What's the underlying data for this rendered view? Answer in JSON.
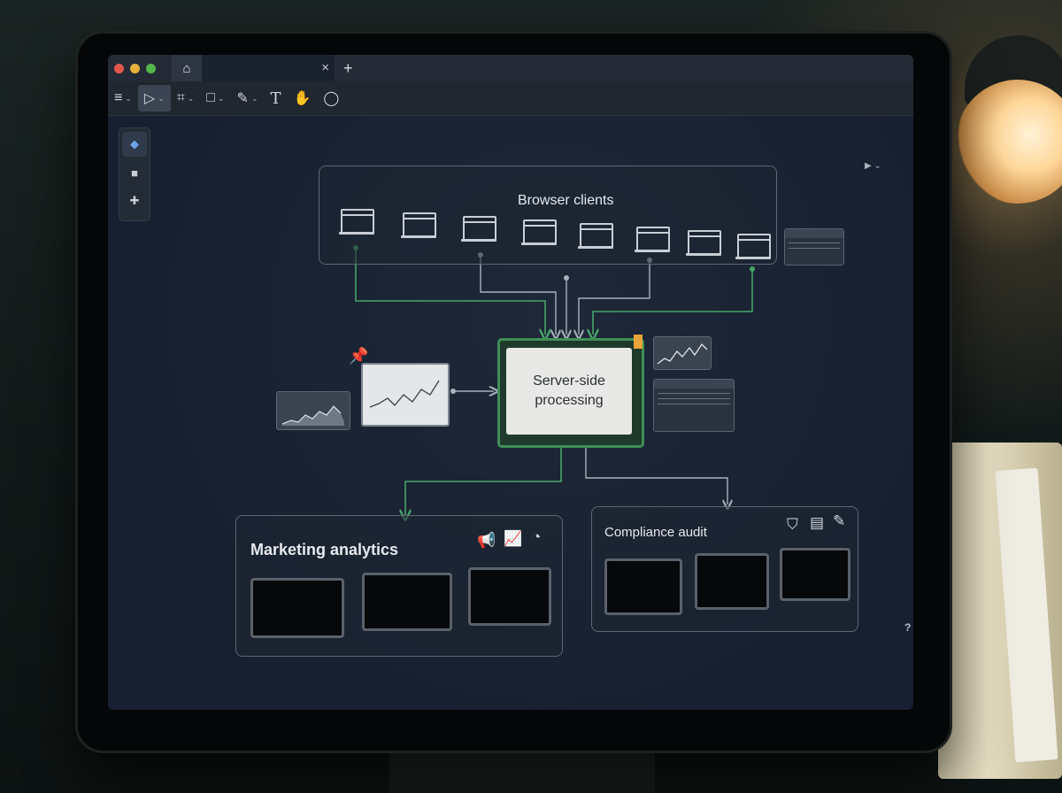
{
  "window": {
    "traffic_colors": [
      "#e2574c",
      "#e6b03a",
      "#53b64a"
    ],
    "home_icon": "home-icon",
    "close_glyph": "×",
    "new_tab_glyph": "+"
  },
  "toolbar": {
    "tools": [
      {
        "name": "menu-tool",
        "icon": "≡",
        "caret": "⌄"
      },
      {
        "name": "select-tool",
        "icon": "▷",
        "caret": "⌄",
        "active": true
      },
      {
        "name": "crop-tool",
        "icon": "⌗",
        "caret": "⌄"
      },
      {
        "name": "rectangle-tool",
        "icon": "□",
        "caret": "⌄"
      },
      {
        "name": "pen-tool",
        "icon": "✎",
        "caret": "⌄"
      },
      {
        "name": "text-tool",
        "icon": "T"
      },
      {
        "name": "hand-tool",
        "icon": "✋"
      },
      {
        "name": "comment-tool",
        "icon": "◯"
      }
    ]
  },
  "left_panel": {
    "items": [
      "layers-icon",
      "folder-icon",
      "plugins-icon"
    ]
  },
  "diagram": {
    "browser_clients": {
      "title": "Browser clients",
      "count": 8
    },
    "server": {
      "label": "Server-side processing"
    },
    "marketing": {
      "title": "Marketing analytics",
      "icons": [
        "megaphone-icon",
        "growth-chart-icon",
        "pie-chart-icon"
      ]
    },
    "compliance": {
      "title": "Compliance audit",
      "icons": [
        "shield-check-icon",
        "clipboard-icon",
        "document-edit-icon"
      ]
    },
    "accent_green": "#4aa36a",
    "connector_gray": "#aab1bb"
  },
  "help": {
    "label": "?"
  }
}
